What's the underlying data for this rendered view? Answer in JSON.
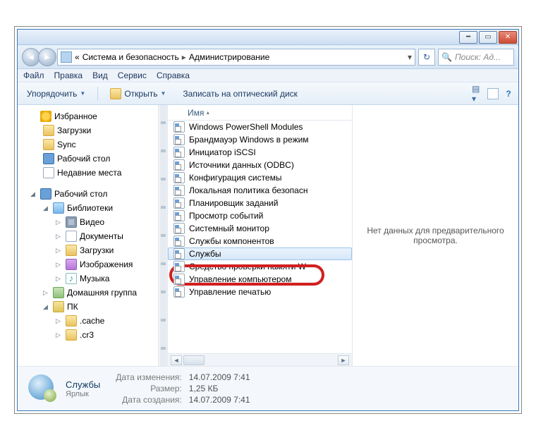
{
  "titlebar": {},
  "nav": {
    "breadcrumb_prefix": "«",
    "crumb1": "Система и безопасность",
    "crumb2": "Администрирование",
    "search_placeholder": "Поиск: Ад..."
  },
  "menu": {
    "file": "Файл",
    "edit": "Правка",
    "view": "Вид",
    "tools": "Сервис",
    "help": "Справка"
  },
  "toolbar": {
    "organize": "Упорядочить",
    "open": "Открыть",
    "burn": "Записать на оптический диск"
  },
  "tree": {
    "favorites": "Избранное",
    "downloads": "Загрузки",
    "sync": "Sync",
    "desktop_fav": "Рабочий стол",
    "recent": "Недавние места",
    "desktop": "Рабочий стол",
    "libraries": "Библиотеки",
    "videos": "Видео",
    "documents": "Документы",
    "downloads2": "Загрузки",
    "pictures": "Изображения",
    "music": "Музыка",
    "homegroup": "Домашняя группа",
    "pc": "ПК",
    "cache": ".cache",
    "cr3": ".cr3"
  },
  "list": {
    "col_name": "Имя",
    "items": [
      "Windows PowerShell Modules",
      "Брандмауэр Windows в режим",
      "Инициатор iSCSI",
      "Источники данных (ODBC)",
      "Конфигурация системы",
      "Локальная политика безопасн",
      "Планировщик заданий",
      "Просмотр событий",
      "Системный монитор",
      "Службы компонентов",
      "Службы",
      "Средство проверки памяти W",
      "Управление компьютером",
      "Управление печатью"
    ]
  },
  "preview": {
    "no_data": "Нет данных для предварительного просмотра."
  },
  "details": {
    "name": "Службы",
    "type": "Ярлык",
    "date_modified_label": "Дата изменения:",
    "date_modified": "14.07.2009 7:41",
    "size_label": "Размер:",
    "size": "1,25 КБ",
    "date_created_label": "Дата создания:",
    "date_created": "14.07.2009 7:41"
  }
}
